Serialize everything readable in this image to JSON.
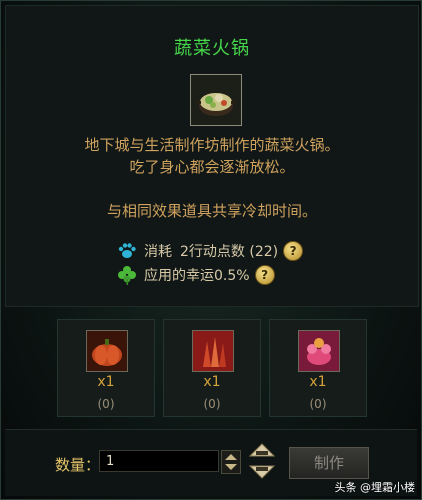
{
  "title": "蔬菜火锅",
  "description": [
    "地下城与生活制作坊制作的蔬菜火锅。",
    "吃了身心都会逐渐放松。",
    "与相同效果道具共享冷却时间。"
  ],
  "cost": {
    "label": "消耗",
    "value": "2行动点数 (22)",
    "icon": "paw-icon"
  },
  "luck": {
    "label": "应用的幸运0.5%",
    "icon": "clover-icon"
  },
  "help_label": "?",
  "materials": [
    {
      "icon": "pumpkin-material-icon",
      "count": "x1",
      "owned": "(0)",
      "color": "#b2361a"
    },
    {
      "icon": "red-root-material-icon",
      "count": "x1",
      "owned": "(0)",
      "color": "#a82424"
    },
    {
      "icon": "pink-flower-material-icon",
      "count": "x1",
      "owned": "(0)",
      "color": "#c83a6a"
    }
  ],
  "quantity": {
    "label": "数量：",
    "value": "1"
  },
  "make_button": "制作",
  "watermark": "头条 @埋霜小楼"
}
